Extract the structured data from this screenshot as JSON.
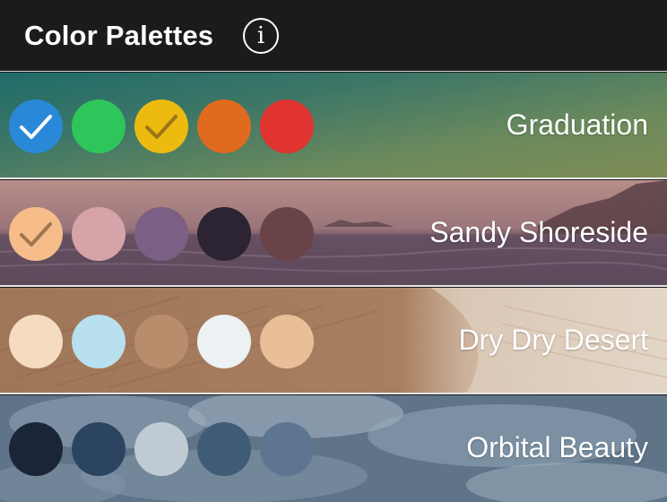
{
  "header": {
    "title": "Color Palettes",
    "info_icon": "info-circle-icon",
    "info_glyph": "i"
  },
  "palettes": [
    {
      "name": "Graduation",
      "selected": true,
      "colors": [
        "#2a88d8",
        "#2ec65b",
        "#edbb10",
        "#e06a1e",
        "#e1332f"
      ],
      "checked": [
        0,
        2
      ]
    },
    {
      "name": "Sandy Shoreside",
      "selected": false,
      "colors": [
        "#f6bd8b",
        "#d6a4a8",
        "#7b5f84",
        "#2c2433",
        "#6a4349"
      ],
      "checked": [
        0
      ]
    },
    {
      "name": "Dry Dry Desert",
      "selected": false,
      "colors": [
        "#f5dcc0",
        "#b8e0ee",
        "#b88d6c",
        "#ecf1f4",
        "#e8bf99"
      ],
      "checked": []
    },
    {
      "name": "Orbital Beauty",
      "selected": false,
      "colors": [
        "#1a2638",
        "#2b4560",
        "#c0cad2",
        "#3f5b76",
        "#5d7590"
      ],
      "checked": []
    }
  ]
}
